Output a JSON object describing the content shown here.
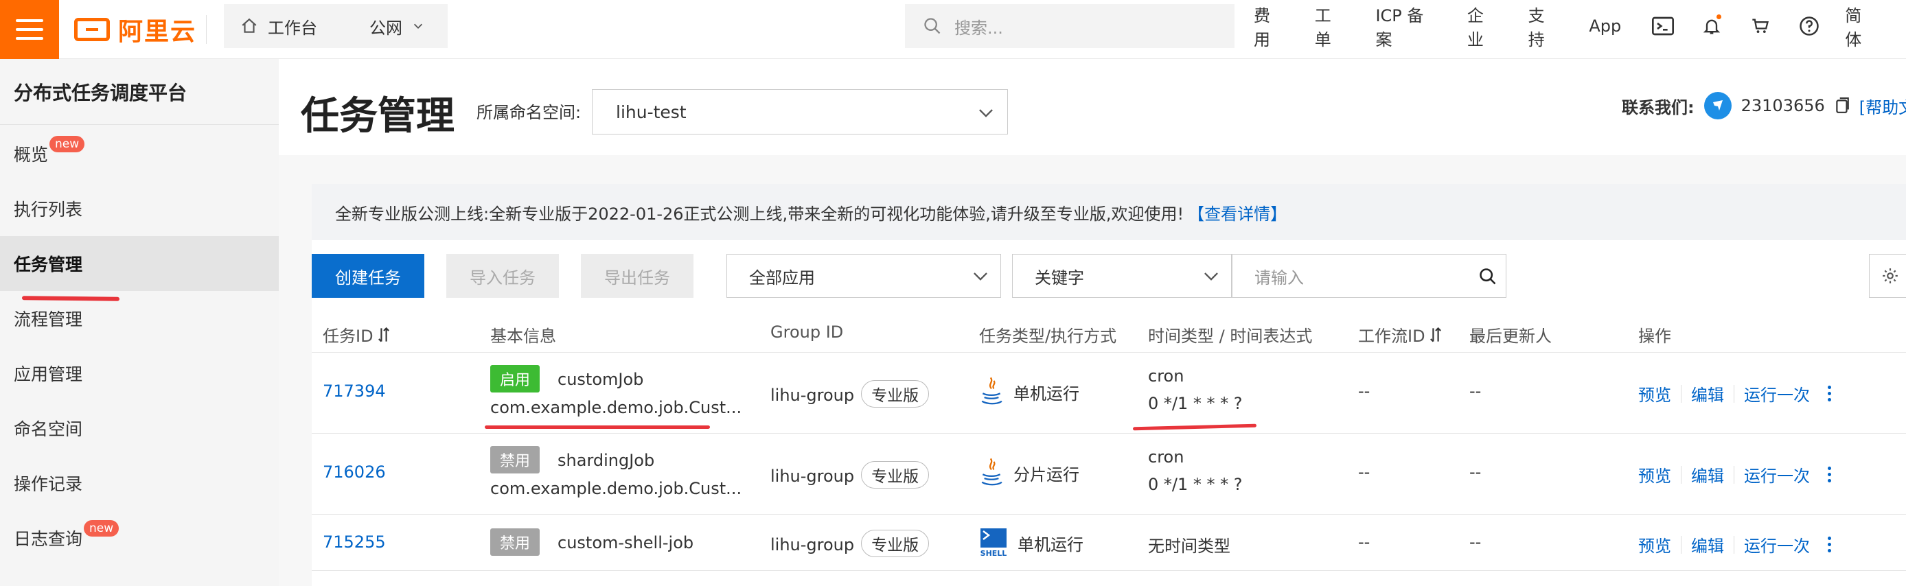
{
  "topbar": {
    "logo_text": "阿里云",
    "workbench": "工作台",
    "network": "公网",
    "search_placeholder": "搜索...",
    "links": [
      "费用",
      "工单",
      "ICP 备案",
      "企业",
      "支持",
      "App"
    ],
    "lang": "简体",
    "accent_color": "#ff6a00"
  },
  "sidebar": {
    "title": "分布式任务调度平台",
    "items": [
      {
        "label": "概览",
        "badge": "new"
      },
      {
        "label": "执行列表",
        "badge": ""
      },
      {
        "label": "任务管理",
        "badge": ""
      },
      {
        "label": "流程管理",
        "badge": ""
      },
      {
        "label": "应用管理",
        "badge": ""
      },
      {
        "label": "命名空间",
        "badge": ""
      },
      {
        "label": "操作记录",
        "badge": ""
      },
      {
        "label": "日志查询",
        "badge": "new"
      }
    ]
  },
  "header": {
    "title": "任务管理",
    "namespace_label": "所属命名空间:",
    "namespace_value": "lihu-test",
    "contact_label": "联系我们:",
    "contact_id": "23103656",
    "help_link": "[帮助文"
  },
  "banner": {
    "text": "全新专业版公测上线:全新专业版于2022-01-26正式公测上线,带来全新的可视化功能体验,请升级至专业版,欢迎使用!",
    "link": "【查看详情】"
  },
  "toolbar": {
    "create": "创建任务",
    "import": "导入任务",
    "export": "导出任务",
    "app_select": "全部应用",
    "keyword_select": "关键字",
    "input_placeholder": "请输入"
  },
  "table": {
    "headers": [
      "任务ID",
      "基本信息",
      "Group ID",
      "任务类型/执行方式",
      "时间类型 / 时间表达式",
      "工作流ID",
      "最后更新人",
      "操作"
    ],
    "rows": [
      {
        "id": "717394",
        "status": "启用",
        "status_type": "on",
        "name": "customJob",
        "class": "com.example.demo.job.Cust...",
        "group": "lihu-group",
        "edition": "专业版",
        "exec_icon": "java-icon",
        "exec": "单机运行",
        "time_type": "cron",
        "time_expr": "0 */1 * * * ?",
        "workflow": "--",
        "updater": "--"
      },
      {
        "id": "716026",
        "status": "禁用",
        "status_type": "off",
        "name": "shardingJob",
        "class": "com.example.demo.job.Cust...",
        "group": "lihu-group",
        "edition": "专业版",
        "exec_icon": "java-icon",
        "exec": "分片运行",
        "time_type": "cron",
        "time_expr": "0 */1 * * * ?",
        "workflow": "--",
        "updater": "--"
      },
      {
        "id": "715255",
        "status": "禁用",
        "status_type": "off",
        "name": "custom-shell-job",
        "class": "",
        "group": "lihu-group",
        "edition": "专业版",
        "exec_icon": "shell-icon",
        "exec": "单机运行",
        "time_type": "无时间类型",
        "time_expr": "",
        "workflow": "--",
        "updater": "--"
      }
    ],
    "ops": [
      "预览",
      "编辑",
      "运行一次"
    ]
  },
  "shell_icon_text": "SHELL"
}
